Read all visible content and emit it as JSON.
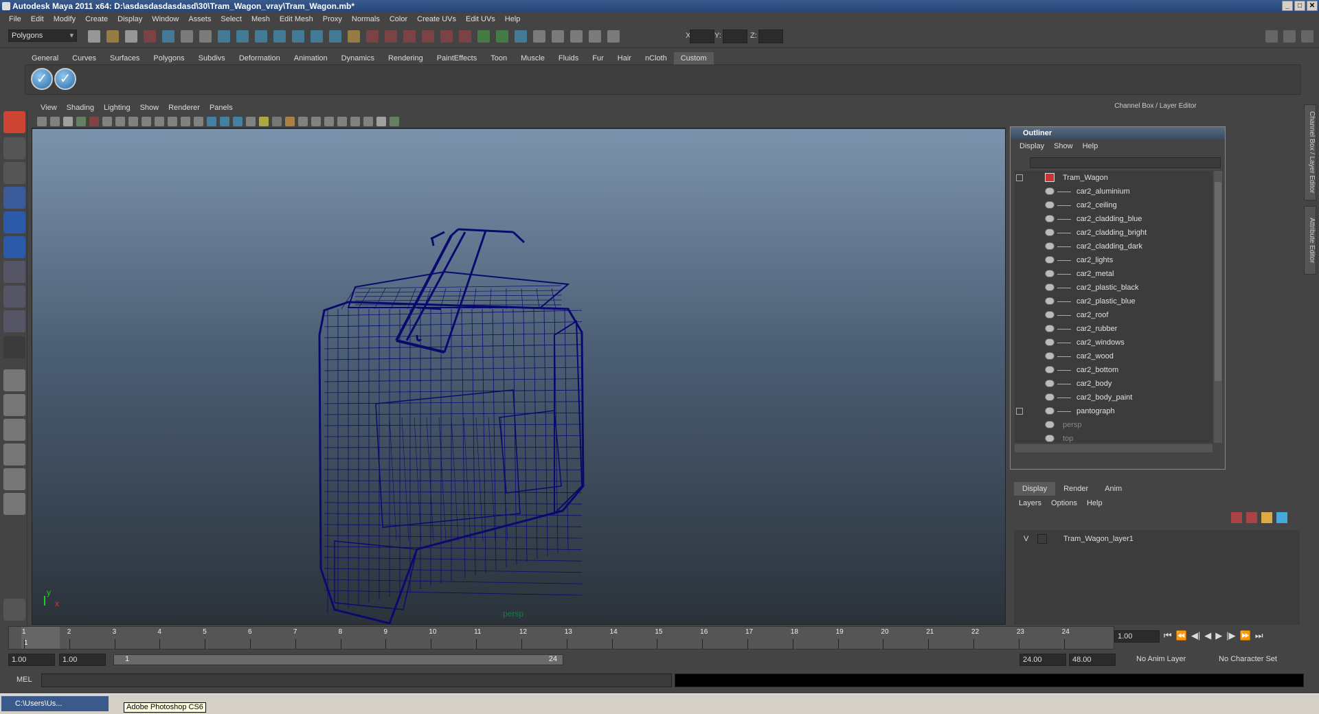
{
  "window": {
    "title": "Autodesk Maya 2011 x64: D:\\asdasdasdasdasd\\30\\Tram_Wagon_vray\\Tram_Wagon.mb*"
  },
  "menubar": [
    "File",
    "Edit",
    "Modify",
    "Create",
    "Display",
    "Window",
    "Assets",
    "Select",
    "Mesh",
    "Edit Mesh",
    "Proxy",
    "Normals",
    "Color",
    "Create UVs",
    "Edit UVs",
    "Help"
  ],
  "statusline": {
    "mode": "Polygons",
    "x_label": "X:",
    "y_label": "Y:",
    "z_label": "Z:"
  },
  "shelf": {
    "tabs": [
      "General",
      "Curves",
      "Surfaces",
      "Polygons",
      "Subdivs",
      "Deformation",
      "Animation",
      "Dynamics",
      "Rendering",
      "PaintEffects",
      "Toon",
      "Muscle",
      "Fluids",
      "Fur",
      "Hair",
      "nCloth",
      "Custom"
    ],
    "active_tab": "Custom"
  },
  "viewport": {
    "menu": [
      "View",
      "Shading",
      "Lighting",
      "Show",
      "Renderer",
      "Panels"
    ],
    "camera_label": "persp",
    "axis_y": "y",
    "axis_x": "x",
    "wire_color": "#0a0a6e"
  },
  "channel_box": {
    "header": "Channel Box / Layer Editor"
  },
  "outliner": {
    "title": "Outliner",
    "menu": [
      "Display",
      "Show",
      "Help"
    ],
    "items": [
      {
        "label": "Tram_Wagon",
        "root": true
      },
      {
        "label": "car2_aluminium"
      },
      {
        "label": "car2_ceiling"
      },
      {
        "label": "car2_cladding_blue"
      },
      {
        "label": "car2_cladding_bright"
      },
      {
        "label": "car2_cladding_dark"
      },
      {
        "label": "car2_lights"
      },
      {
        "label": "car2_metal"
      },
      {
        "label": "car2_plastic_black"
      },
      {
        "label": "car2_plastic_blue"
      },
      {
        "label": "car2_roof"
      },
      {
        "label": "car2_rubber"
      },
      {
        "label": "car2_windows"
      },
      {
        "label": "car2_wood"
      },
      {
        "label": "car2_bottom"
      },
      {
        "label": "car2_body"
      },
      {
        "label": "car2_body_paint"
      },
      {
        "label": "pantograph",
        "expand": true
      },
      {
        "label": "persp",
        "dim": true
      },
      {
        "label": "top",
        "dim": true
      }
    ]
  },
  "layer_editor": {
    "tabs": [
      "Display",
      "Render",
      "Anim"
    ],
    "active_tab": "Display",
    "menu": [
      "Layers",
      "Options",
      "Help"
    ],
    "layers": [
      {
        "visible": "V",
        "name": "Tram_Wagon_layer1"
      }
    ]
  },
  "timeline": {
    "frames": [
      "1",
      "2",
      "3",
      "4",
      "5",
      "6",
      "7",
      "8",
      "9",
      "10",
      "11",
      "12",
      "13",
      "14",
      "15",
      "16",
      "17",
      "18",
      "19",
      "20",
      "21",
      "22",
      "23",
      "24"
    ],
    "current_frame": "1.00",
    "current_marker": "1"
  },
  "range": {
    "start": "1.00",
    "anim_start": "1.00",
    "slider_start": "1",
    "slider_end": "24",
    "end": "24.00",
    "anim_end": "48.00",
    "anim_layer": "No Anim Layer",
    "char_set": "No Character Set"
  },
  "cmdline": {
    "label": "MEL"
  },
  "taskbar": {
    "item": "C:\\Users\\Us...",
    "tooltip": "Adobe Photoshop CS6"
  },
  "sidetabs": {
    "channel": "Channel Box / Layer Editor",
    "attr": "Attribute Editor"
  }
}
